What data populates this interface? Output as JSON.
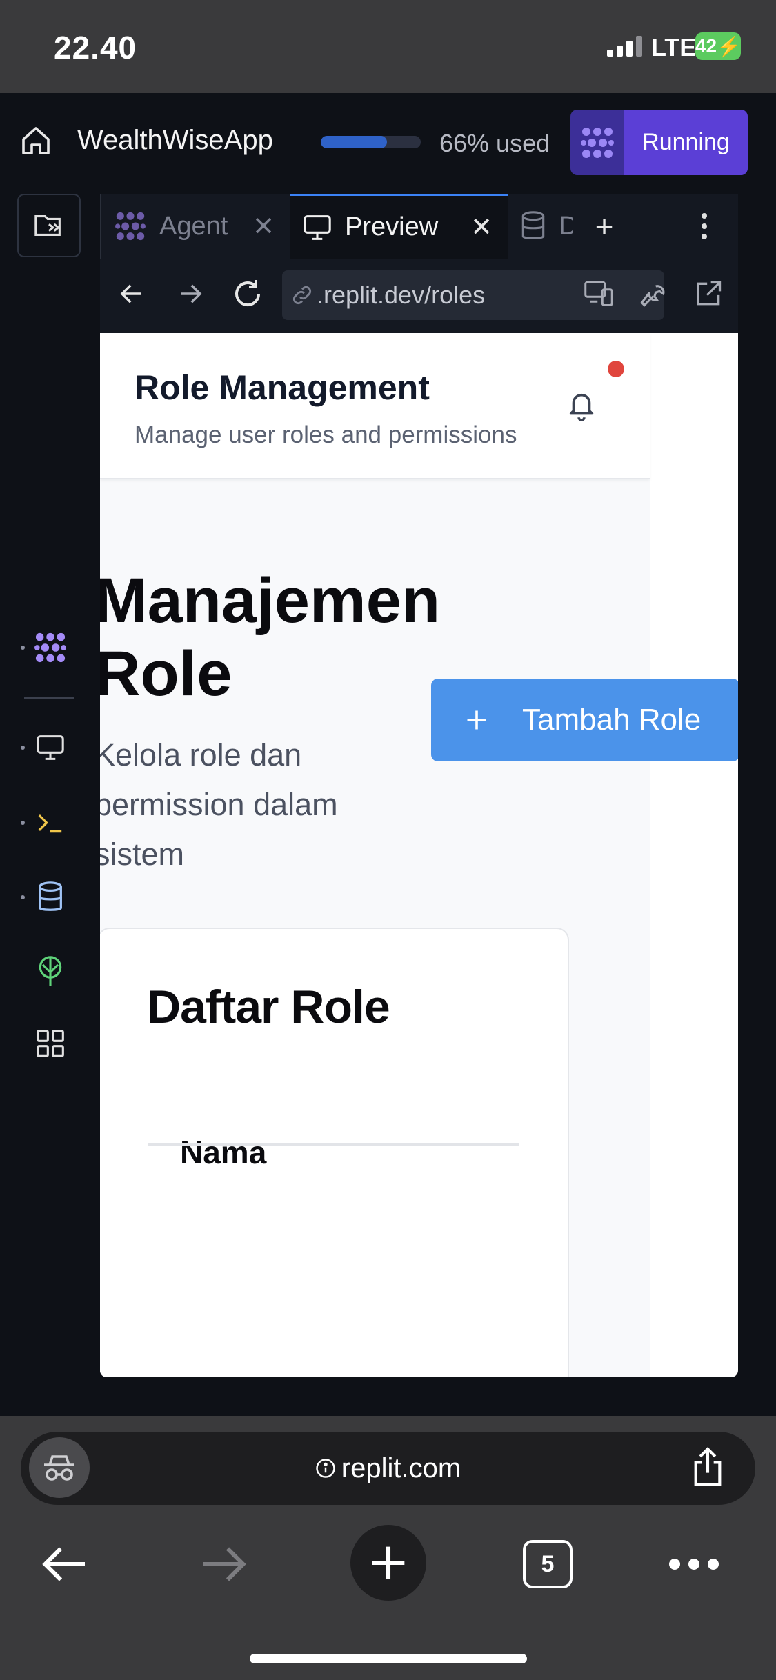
{
  "status_bar": {
    "time": "22.40",
    "network": "LTE",
    "battery": "42"
  },
  "header": {
    "app_name": "WealthWiseApp",
    "usage_text": "66% used",
    "usage_fraction": 0.66,
    "run_label": "Running",
    "accent": "#5b3fd6"
  },
  "tabs": [
    {
      "label": "Agent",
      "icon": "replit-agent-icon",
      "active": false
    },
    {
      "label": "Preview",
      "icon": "monitor-icon",
      "active": true
    },
    {
      "label": "D",
      "icon": "database-icon",
      "active": false
    }
  ],
  "url_bar": {
    "url": ".replit.dev/roles"
  },
  "sidebar_tools": [
    "replit-agent-icon",
    "monitor-icon",
    "terminal-icon",
    "database-icon",
    "deploy-icon",
    "grid-icon"
  ],
  "web": {
    "header_title": "Role Management",
    "header_subtitle": "Manage user roles and permissions",
    "page_heading": "Manajemen Role",
    "page_description": "Kelola role dan permission dalam sistem",
    "add_button": "Tambah Role",
    "card_title": "Daftar Role",
    "table_columns": [
      "Nama"
    ],
    "button_color": "#4b93ea"
  },
  "browser": {
    "domain": "replit.com",
    "tab_count": "5"
  }
}
